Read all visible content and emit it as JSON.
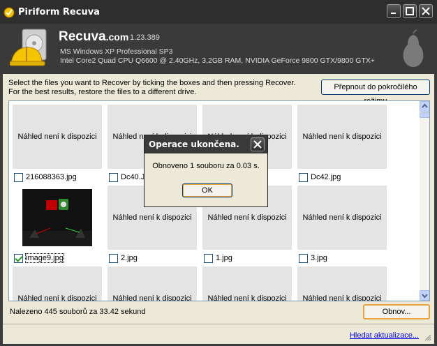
{
  "window": {
    "title": "Piriform Recuva",
    "minimize_icon": "minimize-icon",
    "maximize_icon": "maximize-icon",
    "close_icon": "close-icon"
  },
  "header": {
    "brand": "Recuva",
    "brand_suffix": ".com",
    "version": "1.23.389",
    "os": "MS Windows XP Professional SP3",
    "hardware": "Intel Core2 Quad CPU Q6600 @ 2.40GHz, 3,2GB RAM, NVIDIA GeForce 9800 GTX/9800 GTX+"
  },
  "instructions": {
    "line1": "Select the files you want to Recover by ticking the boxes and then pressing Recover.",
    "line2": "For the best results, restore the files to a different drive."
  },
  "advanced_button": "Přepnout do pokročilého režimu",
  "placeholder_text": "Náhled není k dispozici",
  "files": [
    {
      "name": "216088363.jpg",
      "checked": false,
      "preview": false
    },
    {
      "name": "Dc40.JPG",
      "checked": false,
      "preview": false
    },
    {
      "name": "",
      "checked": false,
      "preview": false
    },
    {
      "name": "Dc42.jpg",
      "checked": false,
      "preview": false
    },
    {
      "name": "image9.jpg",
      "checked": true,
      "preview": true
    },
    {
      "name": "2.jpg",
      "checked": false,
      "preview": false
    },
    {
      "name": "1.jpg",
      "checked": false,
      "preview": false
    },
    {
      "name": "3.jpg",
      "checked": false,
      "preview": false
    },
    {
      "name": "",
      "checked": false,
      "preview": false
    },
    {
      "name": "",
      "checked": false,
      "preview": false
    },
    {
      "name": "",
      "checked": false,
      "preview": false
    },
    {
      "name": "",
      "checked": false,
      "preview": false
    }
  ],
  "status": "Nalezeno 445 souborů za 33.42 sekund",
  "recover_button": "Obnov...",
  "update_link": "Hledat aktualizace...",
  "dialog": {
    "title": "Operace ukončena.",
    "message": "Obnoveno 1 souboru za 0.03 s.",
    "ok": "OK"
  }
}
